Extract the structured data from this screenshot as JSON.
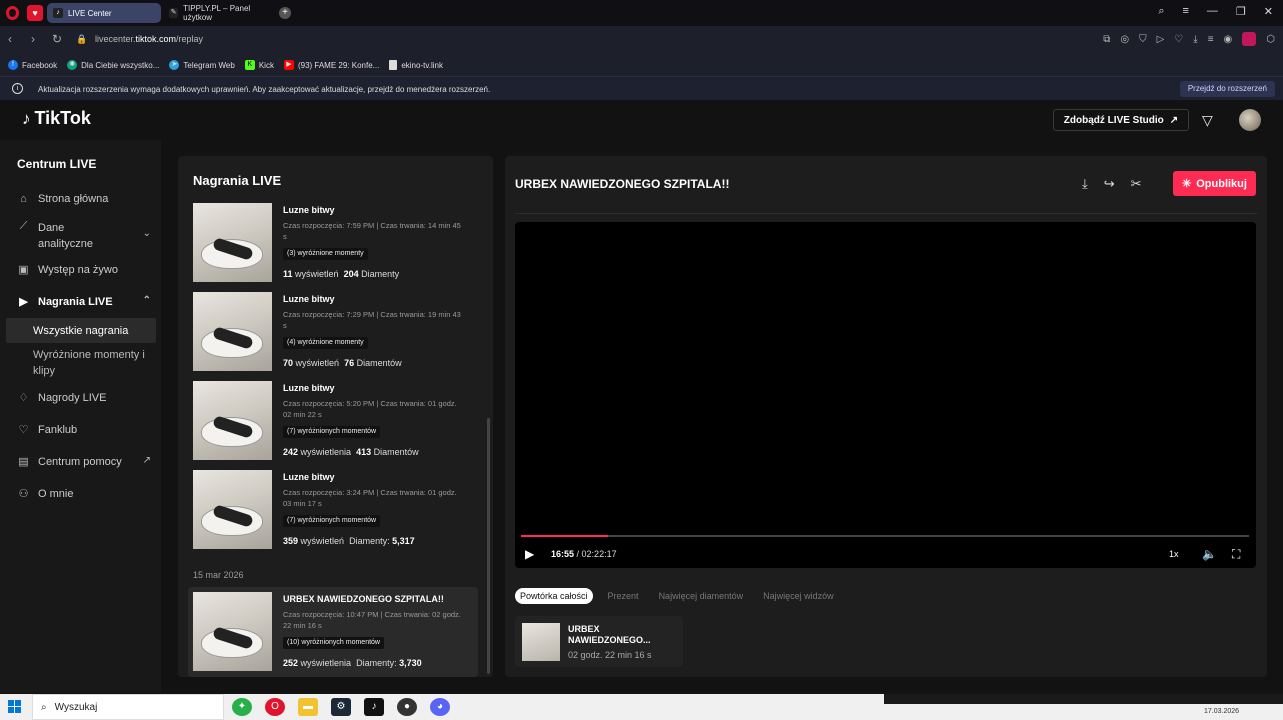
{
  "browser": {
    "tabs": [
      {
        "label": "LIVE Center",
        "icon": "tiktok-icon",
        "active": true
      },
      {
        "label": "TIPPLY.PL – Panel użytkow",
        "icon": "tipply-icon",
        "active": false
      }
    ],
    "url_prefix": "livecenter.",
    "url_domain": "tiktok.com",
    "url_path": "/replay",
    "bookmarks": [
      {
        "label": "Facebook",
        "icon": "facebook-icon",
        "color": "#1877f2"
      },
      {
        "label": "Dla Ciebie wszystko...",
        "icon": "chatgpt-icon",
        "color": "#10a37f"
      },
      {
        "label": "Telegram Web",
        "icon": "telegram-icon",
        "color": "#2aa3de"
      },
      {
        "label": "Kick",
        "icon": "kick-icon",
        "color": "#53fc18"
      },
      {
        "label": "(93) FAME 29: Konfe...",
        "icon": "youtube-icon",
        "color": "#ff0000"
      },
      {
        "label": "ekino-tv.link",
        "icon": "page-icon",
        "color": "#dddddd"
      }
    ],
    "notice_text": "Aktualizacja rozszerzenia wymaga dodatkowych uprawnień. Aby zaakceptować aktualizacje, przejdź do menedżera rozszerzeń.",
    "notice_button": "Przejdź do rozszerzeń"
  },
  "header": {
    "logo": "TikTok",
    "studio_button": "Zdobądź LIVE Studio"
  },
  "sidebar": {
    "title": "Centrum LIVE",
    "items": [
      {
        "label": "Strona główna",
        "icon": "home-icon"
      },
      {
        "label": "Dane analityczne",
        "icon": "analytics-icon"
      },
      {
        "label": "Występ na żywo",
        "icon": "live-icon"
      },
      {
        "label": "Nagrania LIVE",
        "icon": "recordings-icon"
      },
      {
        "label": "Nagrody LIVE",
        "icon": "rewards-icon"
      },
      {
        "label": "Fanklub",
        "icon": "fanclub-icon"
      },
      {
        "label": "Centrum pomocy",
        "icon": "help-icon"
      },
      {
        "label": "O mnie",
        "icon": "profile-icon"
      }
    ],
    "sub_items": [
      {
        "label": "Wszystkie nagrania"
      },
      {
        "label": "Wyróżnione momenty i klipy"
      }
    ]
  },
  "recordings": {
    "title": "Nagrania LIVE",
    "date_separator": "15 mar 2026",
    "items": [
      {
        "name": "Luzne bitwy",
        "meta": "Czas rozpoczęcia: 7:59 PM | Czas trwania: 14 min 45 s",
        "badge": "(3) wyróżnione momenty",
        "views": "11",
        "views_label": "wyświetleń",
        "diamonds": "204",
        "diamonds_label": "Diamenty"
      },
      {
        "name": "Luzne bitwy",
        "meta": "Czas rozpoczęcia: 7:29 PM | Czas trwania: 19 min 43 s",
        "badge": "(4) wyróżnione momenty",
        "views": "70",
        "views_label": "wyświetleń",
        "diamonds": "76",
        "diamonds_label": "Diamentów"
      },
      {
        "name": "Luzne bitwy",
        "meta": "Czas rozpoczęcia: 5:20 PM | Czas trwania: 01 godz. 02 min 22 s",
        "badge": "(7) wyróżnionych momentów",
        "views": "242",
        "views_label": "wyświetlenia",
        "diamonds": "413",
        "diamonds_label": "Diamentów"
      },
      {
        "name": "Luzne bitwy",
        "meta": "Czas rozpoczęcia: 3:24 PM | Czas trwania: 01 godz. 03 min 17 s",
        "badge": "(7) wyróżnionych momentów",
        "views": "359",
        "views_label": "wyświetleń",
        "diamonds": "5,317",
        "diamonds_label": "Diamenty:"
      },
      {
        "name": "URBEX NAWIEDZONEGO SZPITALA!!",
        "meta": "Czas rozpoczęcia: 10:47 PM | Czas trwania: 02 godz. 22 min 16 s",
        "badge": "(10) wyróżnionych momentów",
        "views": "252",
        "views_label": "wyświetlenia",
        "diamonds": "3,730",
        "diamonds_label": "Diamenty:"
      }
    ]
  },
  "player": {
    "title": "URBEX NAWIEDZONEGO SZPITALA!!",
    "publish_button": "Opublikuj",
    "current_time": "16:55",
    "total_time": "02:22:17",
    "progress": 0.119,
    "speed": "1x",
    "filters": [
      "Powtórka całości",
      "Prezent",
      "Najwięcej diamentów",
      "Najwięcej widzów"
    ],
    "clip": {
      "name": "URBEX NAWIEDZONEGO...",
      "duration": "02 godz. 22 min 16 s"
    }
  },
  "taskbar": {
    "search_placeholder": "Wyszukaj",
    "date": "17.03.2026"
  },
  "colors": {
    "accent": "#fe2c55",
    "background": "#121212",
    "panel": "#1d1d1d"
  }
}
